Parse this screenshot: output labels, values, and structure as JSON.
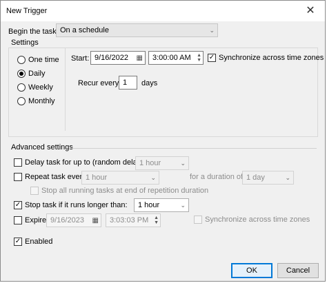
{
  "window": {
    "title": "New Trigger",
    "close": "✕"
  },
  "begin": {
    "label": "Begin the task:",
    "value": "On a schedule"
  },
  "settings": {
    "legend": "Settings",
    "radios": [
      {
        "label": "One time",
        "selected": false
      },
      {
        "label": "Daily",
        "selected": true
      },
      {
        "label": "Weekly",
        "selected": false
      },
      {
        "label": "Monthly",
        "selected": false
      }
    ],
    "start_label": "Start:",
    "start_date": "9/16/2022",
    "start_time": "3:00:00 AM",
    "sync_label": "Synchronize across time zones",
    "recur_label": "Recur every:",
    "recur_value": "1",
    "recur_unit": "days"
  },
  "advanced": {
    "legend": "Advanced settings",
    "delay_label": "Delay task for up to (random delay):",
    "delay_value": "1 hour",
    "repeat_label": "Repeat task every:",
    "repeat_value": "1 hour",
    "duration_label": "for a duration of:",
    "duration_value": "1 day",
    "stop_all_label": "Stop all running tasks at end of repetition duration",
    "stop_long_label": "Stop task if it runs longer than:",
    "stop_long_value": "1 hour",
    "expire_label": "Expire:",
    "expire_date": "9/16/2023",
    "expire_time": "3:03:03 PM",
    "expire_sync_label": "Synchronize across time zones",
    "enabled_label": "Enabled"
  },
  "buttons": {
    "ok": "OK",
    "cancel": "Cancel"
  },
  "icons": {
    "check": "✓",
    "chevron": "⌄",
    "calendar": "▦",
    "spin_up": "▲",
    "spin_down": "▼"
  },
  "colors": {
    "accent": "#0078d7",
    "background": "#f0f0f0"
  }
}
